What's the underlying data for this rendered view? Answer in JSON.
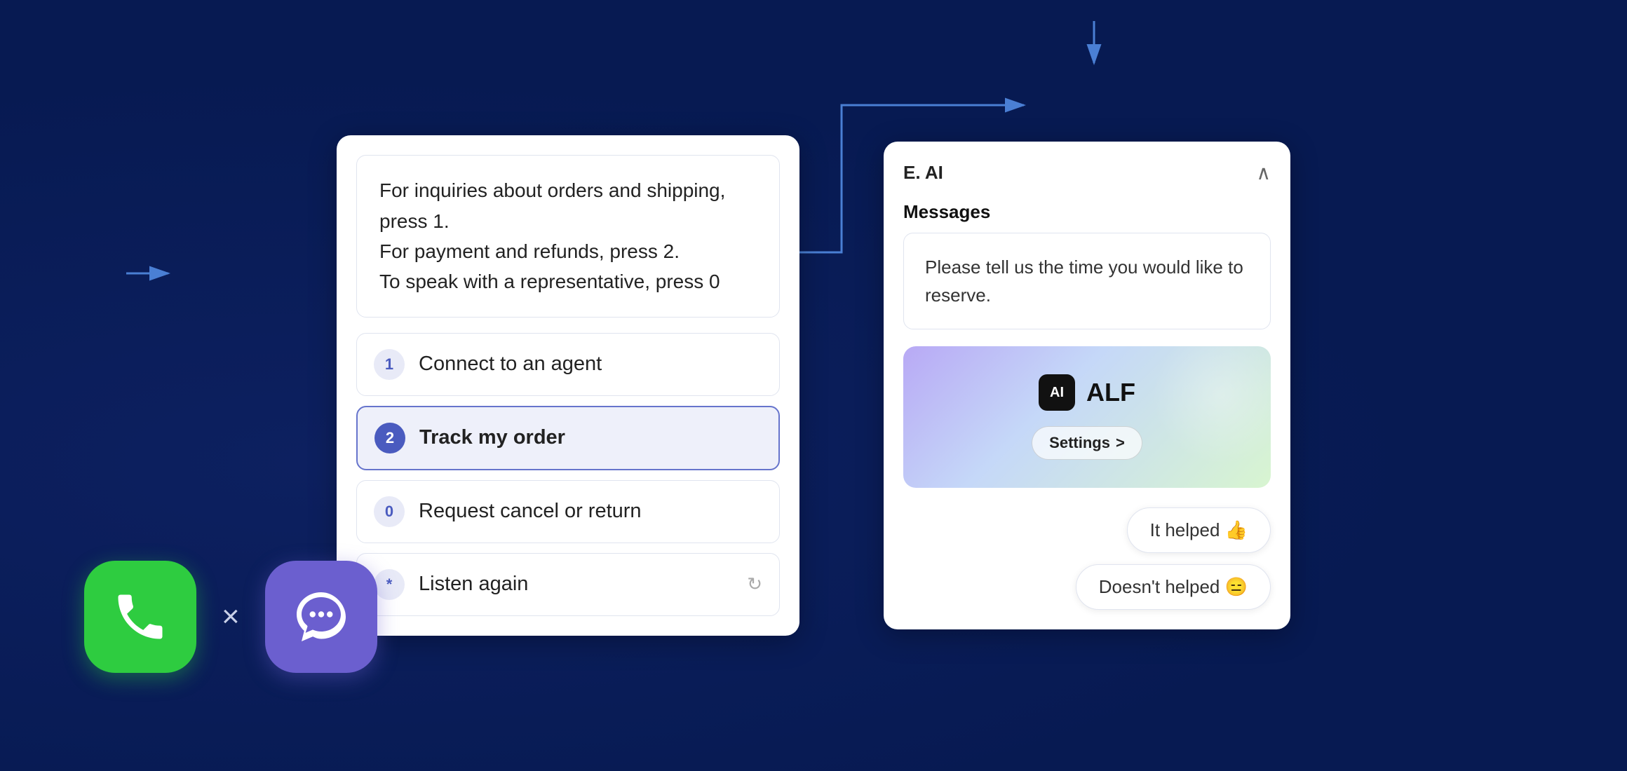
{
  "background": "#071a52",
  "ivr": {
    "message": "For inquiries about orders and shipping, press 1.\nFor payment and refunds, press 2.\nTo speak with a representative, press 0",
    "menu": [
      {
        "key": "1",
        "label": "Connect to an agent",
        "active": false
      },
      {
        "key": "2",
        "label": "Track my order",
        "active": true
      },
      {
        "key": "0",
        "label": "Request cancel or return",
        "active": false
      },
      {
        "key": "*",
        "label": "Listen again",
        "active": false,
        "reload": true
      }
    ]
  },
  "eai": {
    "title": "E. AI",
    "messages_label": "Messages",
    "message": "Please tell us the time you would like to reserve.",
    "alf": {
      "badge": "AI",
      "name": "ALF",
      "settings_label": "Settings",
      "settings_arrow": ">"
    },
    "feedback": [
      {
        "label": "It helped 👍"
      },
      {
        "label": "Doesn't helped 😑"
      }
    ]
  },
  "icons": {
    "times": "×"
  }
}
